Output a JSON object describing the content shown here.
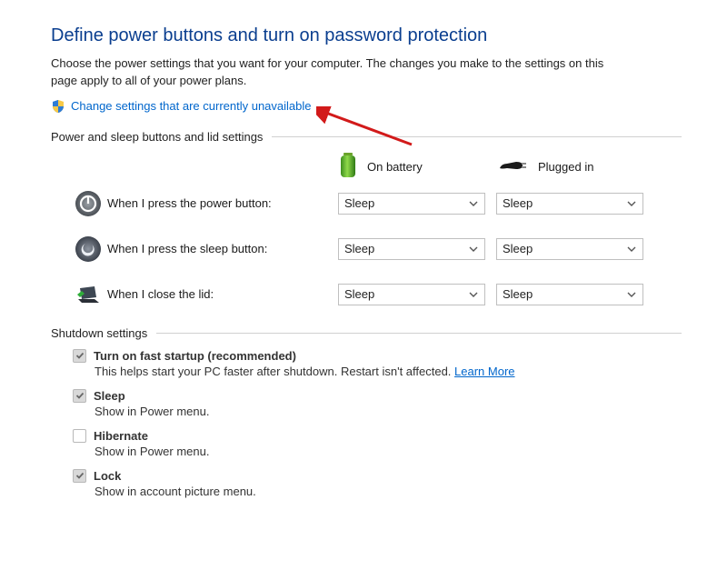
{
  "header": {
    "title": "Define power buttons and turn on password protection",
    "subtitle": "Choose the power settings that you want for your computer. The changes you make to the settings on this page apply to all of your power plans.",
    "change_link": "Change settings that are currently unavailable"
  },
  "group": {
    "buttons_header": "Power and sleep buttons and lid settings",
    "shutdown_header": "Shutdown settings"
  },
  "columns": {
    "battery": "On battery",
    "plugged": "Plugged in"
  },
  "rows": {
    "power": {
      "label": "When I press the power button:",
      "battery": "Sleep",
      "plugged": "Sleep"
    },
    "sleep": {
      "label": "When I press the sleep button:",
      "battery": "Sleep",
      "plugged": "Sleep"
    },
    "lid": {
      "label": "When I close the lid:",
      "battery": "Sleep",
      "plugged": "Sleep"
    }
  },
  "shutdown": {
    "fast_startup": {
      "title": "Turn on fast startup (recommended)",
      "desc": "This helps start your PC faster after shutdown. Restart isn't affected. ",
      "learn_more": "Learn More",
      "checked": true
    },
    "sleep": {
      "title": "Sleep",
      "desc": "Show in Power menu.",
      "checked": true
    },
    "hibernate": {
      "title": "Hibernate",
      "desc": "Show in Power menu.",
      "checked": false
    },
    "lock": {
      "title": "Lock",
      "desc": "Show in account picture menu.",
      "checked": true
    }
  },
  "colors": {
    "link": "#0066cc",
    "heading": "#0a3e8f",
    "arrow": "#d21a1a"
  }
}
